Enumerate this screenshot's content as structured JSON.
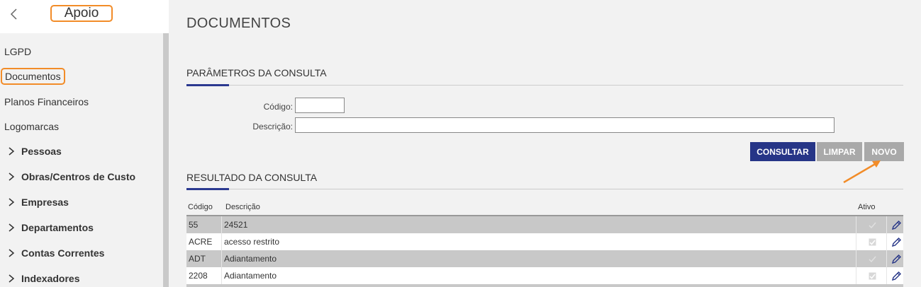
{
  "sidebar": {
    "title": "Apoio",
    "items": [
      {
        "label": "LGPD"
      },
      {
        "label": "Documentos"
      },
      {
        "label": "Planos Financeiros"
      },
      {
        "label": "Logomarcas"
      }
    ],
    "groups": [
      {
        "label": "Pessoas"
      },
      {
        "label": "Obras/Centros de Custo"
      },
      {
        "label": "Empresas"
      },
      {
        "label": "Departamentos"
      },
      {
        "label": "Contas Correntes"
      },
      {
        "label": "Indexadores"
      }
    ]
  },
  "main": {
    "title": "DOCUMENTOS",
    "params": {
      "title": "PARÂMETROS DA CONSULTA",
      "codigo_label": "Código:",
      "codigo_value": "",
      "descricao_label": "Descrição:",
      "descricao_value": ""
    },
    "buttons": {
      "consultar": "CONSULTAR",
      "limpar": "LIMPAR",
      "novo": "NOVO"
    },
    "results": {
      "title": "RESULTADO DA CONSULTA",
      "columns": {
        "codigo": "Código",
        "descricao": "Descrição",
        "ativo": "Ativo"
      },
      "rows": [
        {
          "codigo": "55",
          "descricao": "24521",
          "ativo": true
        },
        {
          "codigo": "ACRE",
          "descricao": "acesso restrito",
          "ativo": true
        },
        {
          "codigo": "ADT",
          "descricao": "Adiantamento",
          "ativo": true
        },
        {
          "codigo": "2208",
          "descricao": "Adiantamento",
          "ativo": true
        }
      ]
    }
  },
  "colors": {
    "accent": "#263587",
    "highlight": "#f28c28",
    "disabled_button": "#a9a9a9"
  }
}
